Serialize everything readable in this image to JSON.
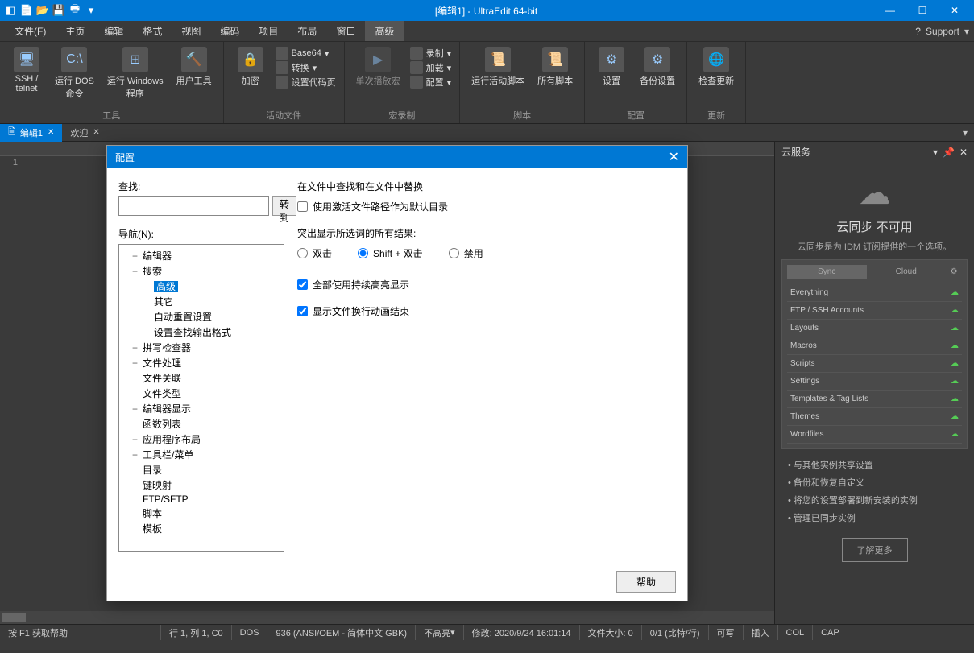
{
  "titlebar": {
    "title": "[编辑1] - UltraEdit 64-bit"
  },
  "menu": {
    "items": [
      "文件(F)",
      "主页",
      "编辑",
      "格式",
      "视图",
      "编码",
      "项目",
      "布局",
      "窗口",
      "高级"
    ],
    "active_index": 9,
    "support": "Support"
  },
  "ribbon": {
    "groups": [
      {
        "label": "工具",
        "buttons": [
          "SSH /\ntelnet",
          "运行 DOS\n命令",
          "运行 Windows\n程序",
          "用户工具"
        ]
      },
      {
        "label": "活动文件",
        "buttons": [
          "加密"
        ],
        "small": [
          "Base64",
          "转换",
          "设置代码页"
        ]
      },
      {
        "label": "宏录制",
        "buttons": [
          "单次播放宏"
        ],
        "small": [
          "录制",
          "加载",
          "配置"
        ]
      },
      {
        "label": "脚本",
        "buttons": [
          "运行活动脚本",
          "所有脚本"
        ]
      },
      {
        "label": "配置",
        "buttons": [
          "设置",
          "备份设置"
        ]
      },
      {
        "label": "更新",
        "buttons": [
          "检查更新"
        ]
      }
    ]
  },
  "tabs": {
    "items": [
      {
        "label": "编辑1",
        "icon": "file",
        "active": true
      },
      {
        "label": "欢迎",
        "active": false
      }
    ]
  },
  "editor": {
    "line_numbers": [
      "1"
    ]
  },
  "sidepanel": {
    "title": "云服务",
    "heading": "云同步 不可用",
    "subtitle": "云同步是为 IDM 订阅提供的一个选项。",
    "tabs": [
      "Sync",
      "Cloud"
    ],
    "items": [
      "Everything",
      "FTP / SSH Accounts",
      "Layouts",
      "Macros",
      "Scripts",
      "Settings",
      "Templates & Tag Lists",
      "Themes",
      "Wordfiles"
    ],
    "bullets": [
      "与其他实例共享设置",
      "备份和恢复自定义",
      "将您的设置部署到新安装的实例",
      "管理已同步实例"
    ],
    "learnmore": "了解更多"
  },
  "statusbar": {
    "help": "按 F1 获取帮助",
    "pos": "行 1, 列 1, C0",
    "enc1": "DOS",
    "enc2": "936  (ANSI/OEM - 简体中文 GBK)",
    "hl": "不高亮",
    "mod": "修改:   2020/9/24 16:01:14",
    "size": "文件大小:   0",
    "sel": "0/1  (比特/行)",
    "rw": "可写",
    "ins": "插入",
    "col": "COL",
    "cap": "CAP"
  },
  "dialog": {
    "title": "配置",
    "find_label": "查找:",
    "goto": "转到",
    "nav_label": "导航(N):",
    "tree": [
      {
        "label": "编辑器",
        "lvl": 1,
        "exp": "+"
      },
      {
        "label": "搜索",
        "lvl": 1,
        "exp": "−"
      },
      {
        "label": "高级",
        "lvl": 2,
        "selected": true
      },
      {
        "label": "其它",
        "lvl": 2
      },
      {
        "label": "自动重置设置",
        "lvl": 2
      },
      {
        "label": "设置查找输出格式",
        "lvl": 2
      },
      {
        "label": "拼写检查器",
        "lvl": 1,
        "exp": "+"
      },
      {
        "label": "文件处理",
        "lvl": 1,
        "exp": "+"
      },
      {
        "label": "文件关联",
        "lvl": 1
      },
      {
        "label": "文件类型",
        "lvl": 1
      },
      {
        "label": "编辑器显示",
        "lvl": 1,
        "exp": "+"
      },
      {
        "label": "函数列表",
        "lvl": 1
      },
      {
        "label": "应用程序布局",
        "lvl": 1,
        "exp": "+"
      },
      {
        "label": "工具栏/菜单",
        "lvl": 1,
        "exp": "+"
      },
      {
        "label": "目录",
        "lvl": 1
      },
      {
        "label": "键映射",
        "lvl": 1
      },
      {
        "label": "FTP/SFTP",
        "lvl": 1
      },
      {
        "label": "脚本",
        "lvl": 1
      },
      {
        "label": "模板",
        "lvl": 1
      }
    ],
    "right": {
      "section1_title": "在文件中查找和在文件中替换",
      "cb1": "使用激活文件路径作为默认目录",
      "section2_title": "突出显示所选词的所有结果:",
      "radio1": "双击",
      "radio2": "Shift + 双击",
      "radio3": "禁用",
      "cb2": "全部使用持续高亮显示",
      "cb3": "显示文件换行动画结束"
    },
    "help_btn": "帮助"
  }
}
